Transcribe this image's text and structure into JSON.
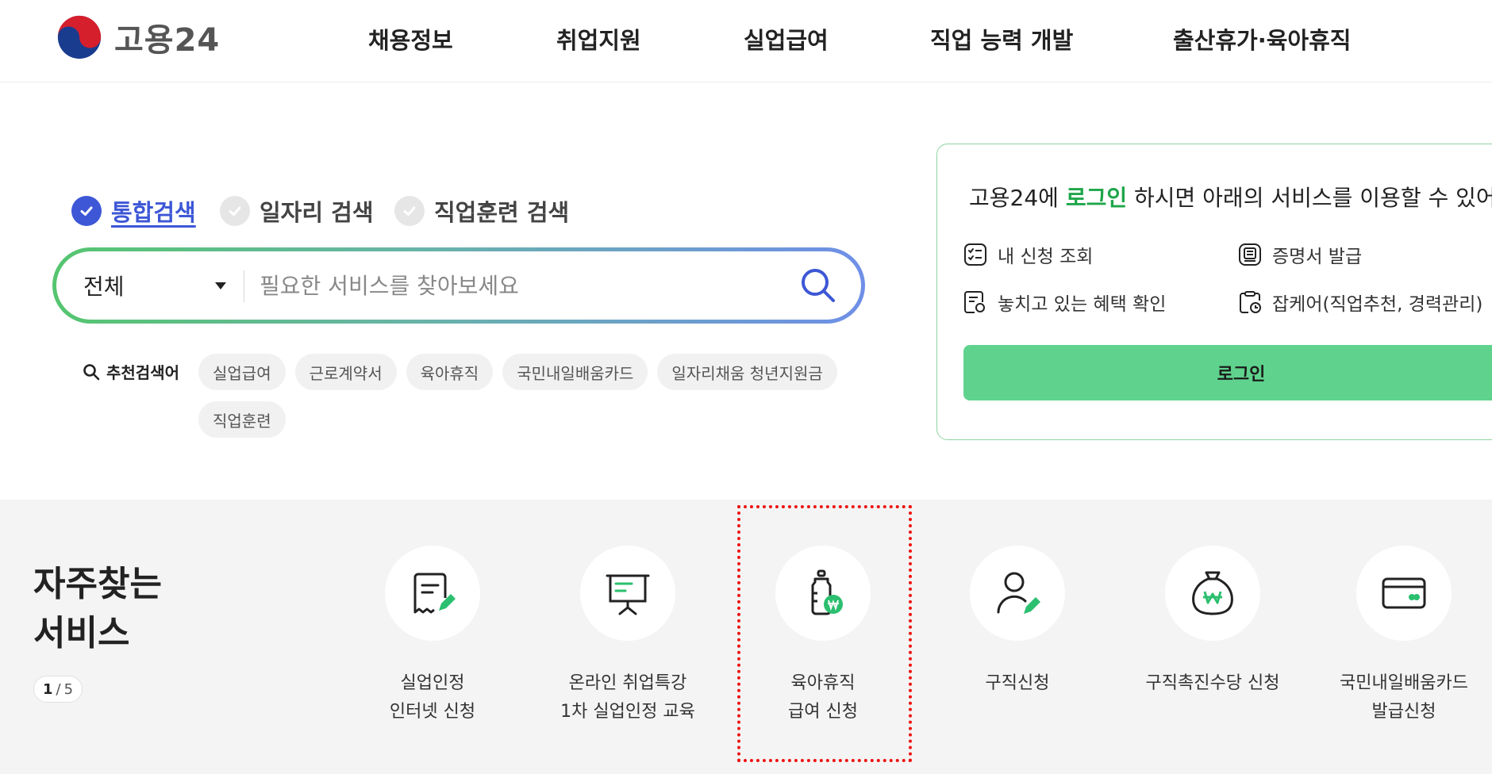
{
  "header": {
    "logo_text": "고용24",
    "nav": [
      "채용정보",
      "취업지원",
      "실업급여",
      "직업 능력 개발",
      "출산휴가·육아휴직"
    ]
  },
  "search": {
    "tabs": [
      {
        "label": "통합검색",
        "active": true
      },
      {
        "label": "일자리 검색",
        "active": false
      },
      {
        "label": "직업훈련 검색",
        "active": false
      }
    ],
    "scope": "전체",
    "placeholder": "필요한 서비스를 찾아보세요",
    "recommend_title": "추천검색어",
    "keywords": [
      "실업급여",
      "근로계약서",
      "육아휴직",
      "국민내일배움카드",
      "일자리채움 청년지원금",
      "직업훈련"
    ]
  },
  "login_panel": {
    "title_prefix": "고용24에 ",
    "title_highlight": "로그인",
    "title_suffix": " 하시면 아래의 서비스를 이용할 수 있어요",
    "services": [
      {
        "label": "내 신청 조회",
        "icon": "checklist-icon"
      },
      {
        "label": "증명서 발급",
        "icon": "certificate-icon"
      },
      {
        "label": "놓치고 있는 혜택 확인",
        "icon": "document-search-icon"
      },
      {
        "label": "잡케어(직업추천, 경력관리)",
        "icon": "clipboard-clock-icon"
      }
    ],
    "button": "로그인"
  },
  "frequent": {
    "title_line1": "자주찾는",
    "title_line2": "서비스",
    "page_current": "1",
    "page_sep": "/",
    "page_total": "5",
    "items": [
      {
        "line1": "실업인정",
        "line2": "인터넷 신청",
        "icon": "receipt-edit-icon"
      },
      {
        "line1": "온라인 취업특강",
        "line2": "1차 실업인정 교육",
        "icon": "presentation-board-icon"
      },
      {
        "line1": "육아휴직",
        "line2": "급여 신청",
        "icon": "baby-bottle-won-icon"
      },
      {
        "line1": "구직신청",
        "line2": "",
        "icon": "user-edit-icon"
      },
      {
        "line1": "구직촉진수당 신청",
        "line2": "",
        "icon": "money-bag-icon"
      },
      {
        "line1": "국민내일배움카드",
        "line2": "발급신청",
        "icon": "card-icon"
      }
    ]
  },
  "colors": {
    "accent_blue": "#3d57d6",
    "login_green": "#5fd38d",
    "highlight_green": "#1ea64a",
    "icon_green": "#2bbf6f",
    "annotation_red": "#e11111"
  }
}
